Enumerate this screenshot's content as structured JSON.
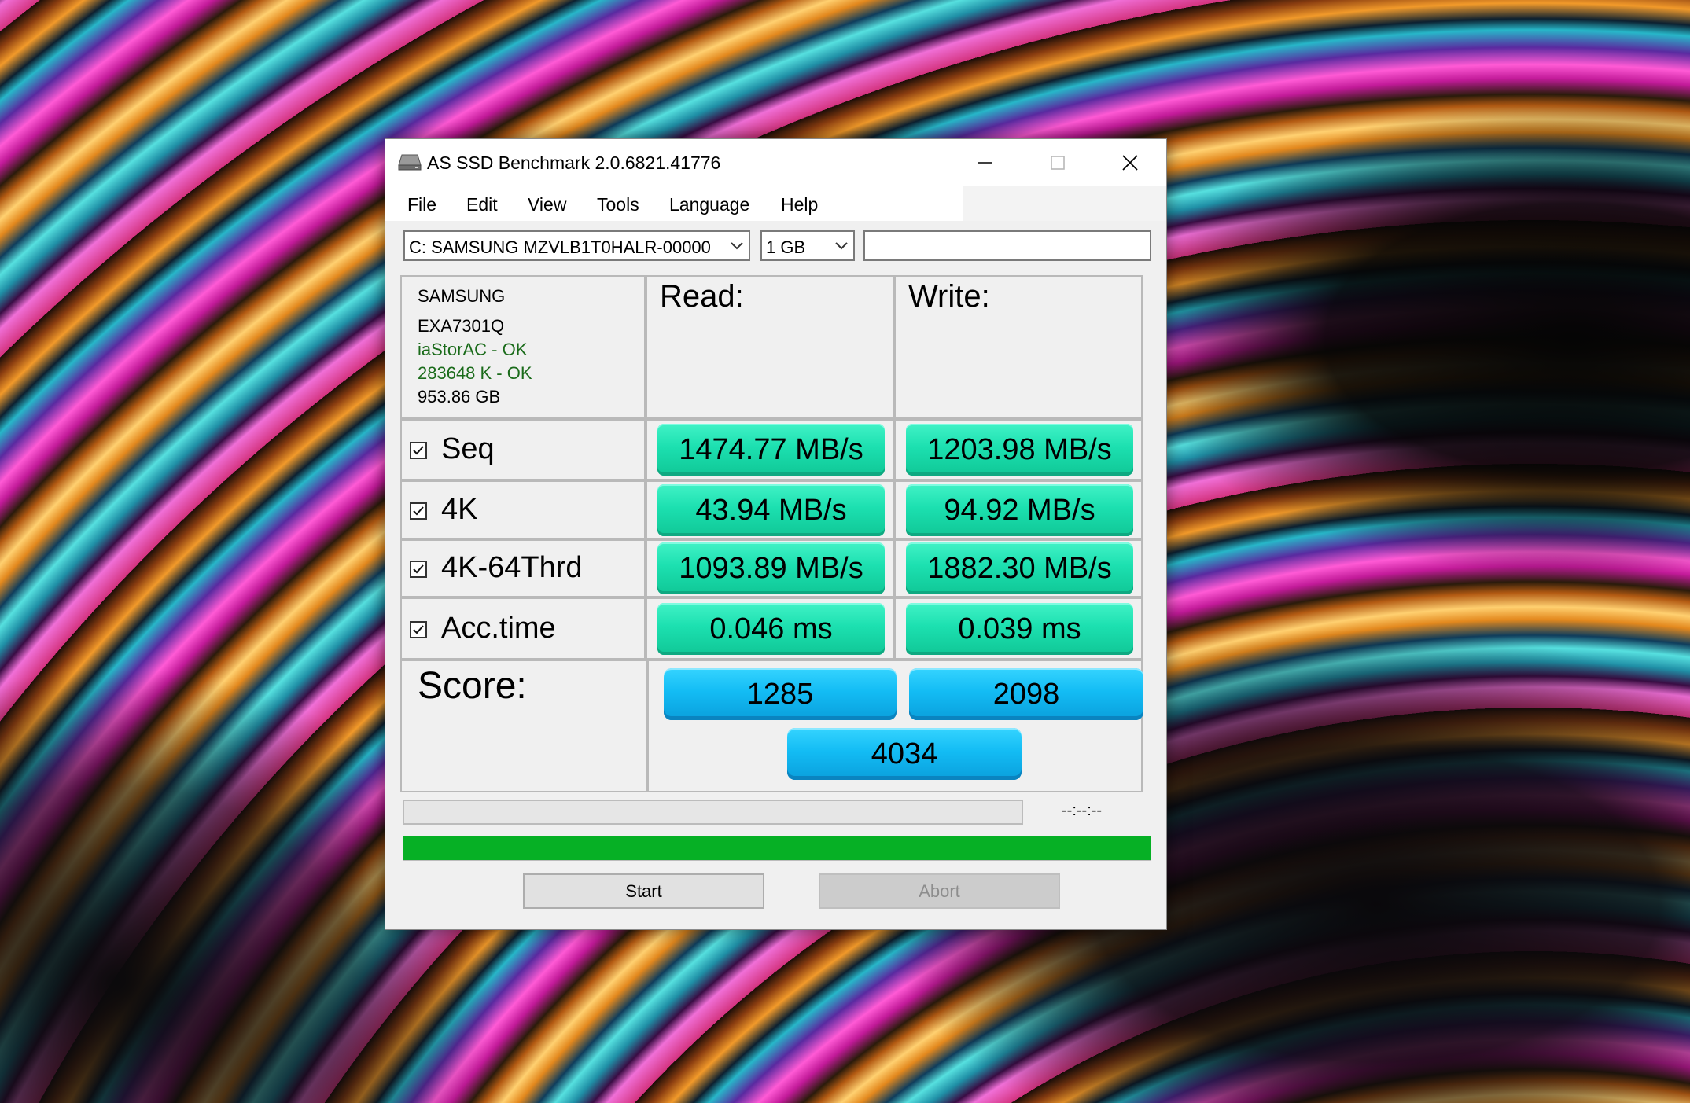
{
  "window": {
    "title": "AS SSD Benchmark 2.0.6821.41776"
  },
  "menu": {
    "items": [
      "File",
      "Edit",
      "View",
      "Tools",
      "Language",
      "Help"
    ]
  },
  "toolbar": {
    "drive": "C: SAMSUNG MZVLB1T0HALR-00000",
    "size": "1 GB",
    "name_value": ""
  },
  "drive_info": {
    "brand": "SAMSUNG",
    "firmware": "EXA7301Q",
    "driver": "iaStorAC - OK",
    "alignment": "283648 K - OK",
    "capacity": "953.86 GB",
    "ok_color": "#1a6b1a"
  },
  "columns": {
    "read": "Read:",
    "write": "Write:"
  },
  "rows": [
    {
      "label": "Seq",
      "checked": true,
      "read": "1474.77 MB/s",
      "write": "1203.98 MB/s"
    },
    {
      "label": "4K",
      "checked": true,
      "read": "43.94 MB/s",
      "write": "94.92 MB/s"
    },
    {
      "label": "4K-64Thrd",
      "checked": true,
      "read": "1093.89 MB/s",
      "write": "1882.30 MB/s"
    },
    {
      "label": "Acc.time",
      "checked": true,
      "read": "0.046 ms",
      "write": "0.039 ms"
    }
  ],
  "score": {
    "label": "Score:",
    "read": "1285",
    "write": "2098",
    "total": "4034"
  },
  "progress": {
    "time": "--:--:--",
    "task_fraction": 0,
    "overall_fraction": 1.0,
    "bar_color": "#06b025"
  },
  "buttons": {
    "start": "Start",
    "abort": "Abort"
  },
  "colors": {
    "result_green": "#1ce0b0",
    "score_blue": "#13bcf4"
  }
}
